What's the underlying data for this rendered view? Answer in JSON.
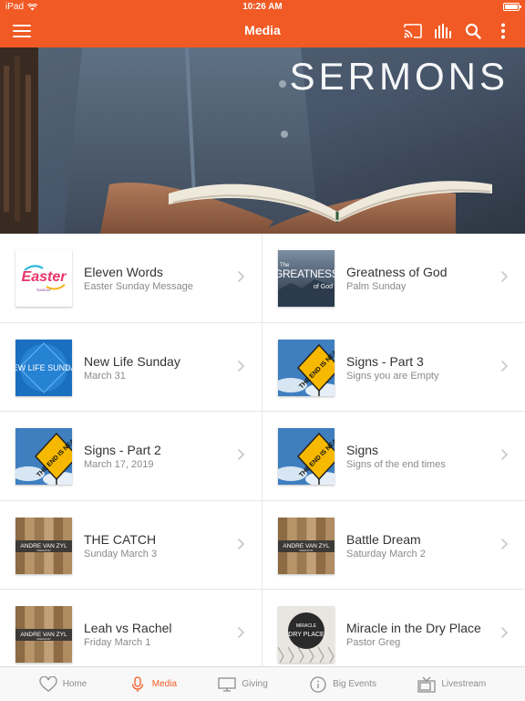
{
  "status_bar": {
    "device": "iPad",
    "time": "10:26 AM",
    "battery_level": 0.85
  },
  "nav": {
    "title": "Media",
    "icons": [
      "menu-icon",
      "cast-icon",
      "audio-bars-icon",
      "search-icon",
      "more-vertical-icon"
    ]
  },
  "banner": {
    "title": "SERMONS"
  },
  "sermons": [
    {
      "title": "Eleven Words",
      "subtitle": "Easter Sunday Message",
      "thumb": "easter",
      "thumb_text": "Easter",
      "thumb_sub": "SUNDAY"
    },
    {
      "title": "Greatness of God",
      "subtitle": "Palm Sunday",
      "thumb": "greatness",
      "thumb_text": "GREATNESS",
      "thumb_pre": "The",
      "thumb_sub": "of God"
    },
    {
      "title": "New Life Sunday",
      "subtitle": "March 31",
      "thumb": "newlife",
      "thumb_text": "NEW LIFE SUNDAY"
    },
    {
      "title": "Signs - Part 3",
      "subtitle": "Signs you are Empty",
      "thumb": "signs",
      "thumb_text": "THE END IS NEAR"
    },
    {
      "title": "Signs - Part 2",
      "subtitle": "March 17, 2019",
      "thumb": "signs",
      "thumb_text": "THE END IS NEAR"
    },
    {
      "title": "Signs",
      "subtitle": "Signs of the end times",
      "thumb": "signs",
      "thumb_text": "THE END IS NEAR"
    },
    {
      "title": "THE CATCH",
      "subtitle": "Sunday March 3",
      "thumb": "andre",
      "thumb_text": "ANDRE VAN ZYL",
      "thumb_sub": "WEEKEND"
    },
    {
      "title": "Battle Dream",
      "subtitle": "Saturday March 2",
      "thumb": "andre",
      "thumb_text": "ANDRE VAN ZYL",
      "thumb_sub": "WEEKEND"
    },
    {
      "title": "Leah vs Rachel",
      "subtitle": "Friday March 1",
      "thumb": "andre",
      "thumb_text": "ANDRE VAN ZYL",
      "thumb_sub": "WEEKEND"
    },
    {
      "title": "Miracle in the Dry Place",
      "subtitle": "Pastor Greg",
      "thumb": "miracle",
      "thumb_text": "MIRACLE",
      "thumb_sub": "DRY PLACE"
    }
  ],
  "tabs": [
    {
      "label": "Home",
      "icon": "heart-icon",
      "active": false
    },
    {
      "label": "Media",
      "icon": "microphone-icon",
      "active": true
    },
    {
      "label": "Giving",
      "icon": "monitor-icon",
      "active": false
    },
    {
      "label": "Big Events",
      "icon": "info-icon",
      "active": false
    },
    {
      "label": "Livestream",
      "icon": "tv-icon",
      "active": false
    }
  ],
  "colors": {
    "accent": "#f15a24",
    "tab_inactive": "#8e8e8e"
  }
}
